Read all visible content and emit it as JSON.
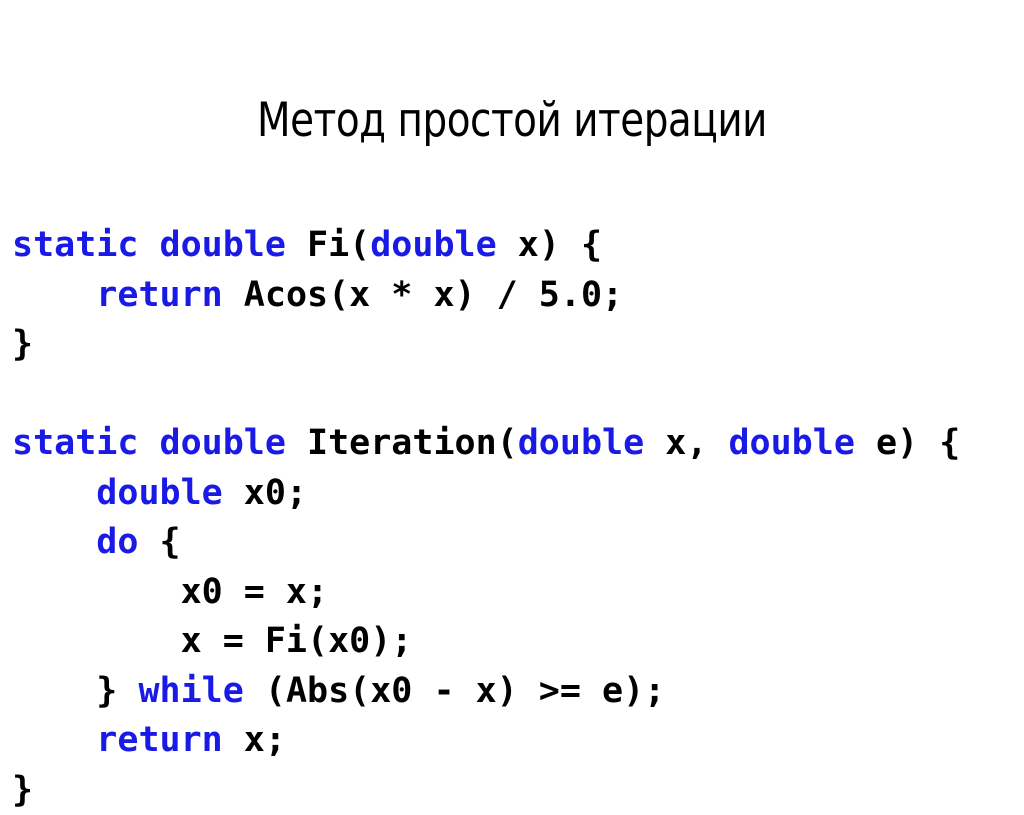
{
  "slide": {
    "title": "Метод простой итерации",
    "background_color": "#ffffff",
    "text_color": "#000000",
    "keyword_color": "#1a1ae6"
  },
  "code": {
    "language": "csharp",
    "lines": [
      {
        "id": "line-1",
        "text": "static double Fi(double x) {",
        "tokens": [
          {
            "t": "static double ",
            "kw": true
          },
          {
            "t": "Fi(",
            "kw": false
          },
          {
            "t": "double",
            "kw": true
          },
          {
            "t": " x) {",
            "kw": false
          }
        ]
      },
      {
        "id": "line-2",
        "text": "    return Acos(x * x) / 5.0;",
        "tokens": [
          {
            "t": "    ",
            "kw": false
          },
          {
            "t": "return",
            "kw": true
          },
          {
            "t": " Acos(x * x) / 5.0;",
            "kw": false
          }
        ]
      },
      {
        "id": "line-3",
        "text": "}",
        "tokens": [
          {
            "t": "}",
            "kw": false
          }
        ]
      },
      {
        "id": "line-4",
        "text": "",
        "tokens": []
      },
      {
        "id": "line-5",
        "text": "static double Iteration(double x, double e) {",
        "tokens": [
          {
            "t": "static double ",
            "kw": true
          },
          {
            "t": "Iteration(",
            "kw": false
          },
          {
            "t": "double",
            "kw": true
          },
          {
            "t": " x, ",
            "kw": false
          },
          {
            "t": "double",
            "kw": true
          },
          {
            "t": " e) {",
            "kw": false
          }
        ]
      },
      {
        "id": "line-6",
        "text": "    double x0;",
        "tokens": [
          {
            "t": "    ",
            "kw": false
          },
          {
            "t": "double",
            "kw": true
          },
          {
            "t": " x0;",
            "kw": false
          }
        ]
      },
      {
        "id": "line-7",
        "text": "    do {",
        "tokens": [
          {
            "t": "    ",
            "kw": false
          },
          {
            "t": "do",
            "kw": true
          },
          {
            "t": " {",
            "kw": false
          }
        ]
      },
      {
        "id": "line-8",
        "text": "        x0 = x;",
        "tokens": [
          {
            "t": "        x0 = x;",
            "kw": false
          }
        ]
      },
      {
        "id": "line-9",
        "text": "        x = Fi(x0);",
        "tokens": [
          {
            "t": "        x = Fi(x0);",
            "kw": false
          }
        ]
      },
      {
        "id": "line-10",
        "text": "    } while (Abs(x0 - x) >= e);",
        "tokens": [
          {
            "t": "    } ",
            "kw": false
          },
          {
            "t": "while",
            "kw": true
          },
          {
            "t": " (Abs(x0 - x) >= e);",
            "kw": false
          }
        ]
      },
      {
        "id": "line-11",
        "text": "    return x;",
        "tokens": [
          {
            "t": "    ",
            "kw": false
          },
          {
            "t": "return",
            "kw": true
          },
          {
            "t": " x;",
            "kw": false
          }
        ]
      },
      {
        "id": "line-12",
        "text": "}",
        "tokens": [
          {
            "t": "}",
            "kw": false
          }
        ]
      }
    ]
  }
}
